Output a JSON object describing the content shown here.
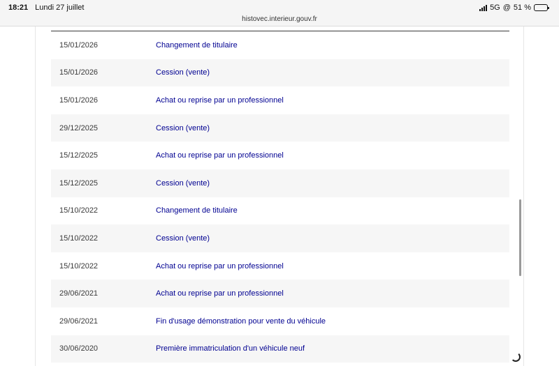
{
  "status_bar": {
    "time": "18:21",
    "date": "Lundi 27 juillet",
    "network": "5G",
    "battery_percent_label": "51 %",
    "battery_level": 0.51
  },
  "browser": {
    "url": "histovec.interieur.gouv.fr"
  },
  "history": {
    "rows": [
      {
        "date": "15/01/2026",
        "event": "Changement de titulaire"
      },
      {
        "date": "15/01/2026",
        "event": "Cession (vente)"
      },
      {
        "date": "15/01/2026",
        "event": "Achat ou reprise par un professionnel"
      },
      {
        "date": "29/12/2025",
        "event": "Cession (vente)"
      },
      {
        "date": "15/12/2025",
        "event": "Achat ou reprise par un professionnel"
      },
      {
        "date": "15/12/2025",
        "event": "Cession (vente)"
      },
      {
        "date": "15/10/2022",
        "event": "Changement de titulaire"
      },
      {
        "date": "15/10/2022",
        "event": "Cession (vente)"
      },
      {
        "date": "15/10/2022",
        "event": "Achat ou reprise par un professionnel"
      },
      {
        "date": "29/06/2021",
        "event": "Achat ou reprise par un professionnel"
      },
      {
        "date": "29/06/2021",
        "event": "Fin d'usage démonstration pour vente du véhicule"
      },
      {
        "date": "30/06/2020",
        "event": "Première immatriculation d'un véhicule neuf"
      }
    ]
  },
  "colors": {
    "link_blue": "#000091",
    "row_alt": "#f6f6f6"
  }
}
